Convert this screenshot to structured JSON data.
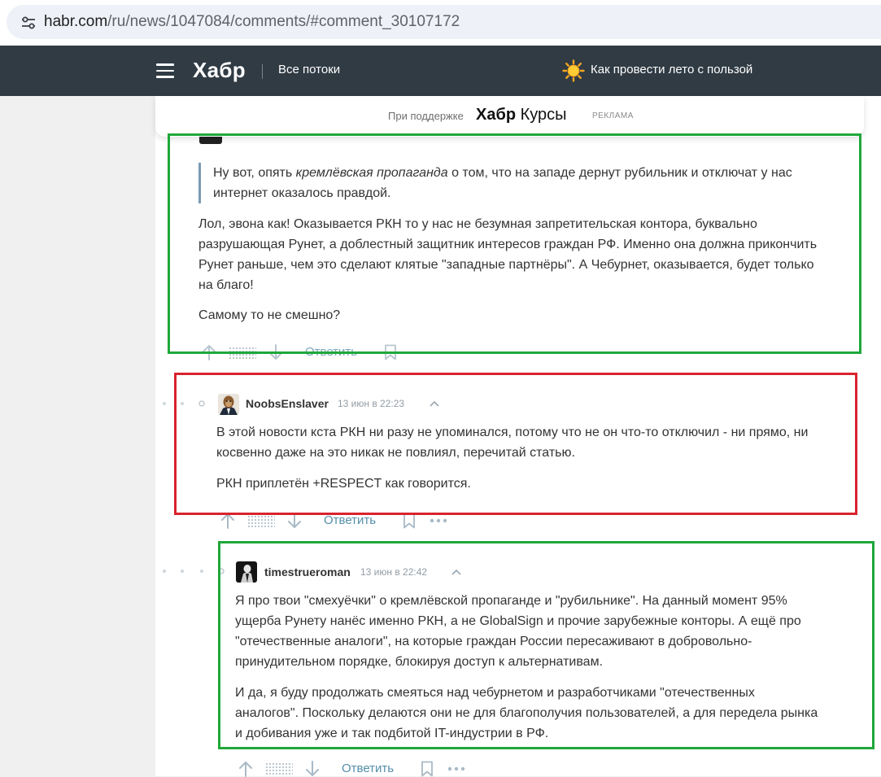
{
  "browser": {
    "url_host": "habr.com",
    "url_path": "/ru/news/1047084/comments/#comment_30107172",
    "site_info_icon": "tune-icon"
  },
  "header": {
    "logo": "Хабр",
    "streams": "Все потоки",
    "promo": "Как провести лето с пользой",
    "promo_icon": "sun-icon"
  },
  "sponsor": {
    "support_text": "При поддержке",
    "logo_bold": "Хабр",
    "logo_regular": "Курсы",
    "ad_label": "РЕКЛАМА"
  },
  "comments": [
    {
      "quote_plain": "Ну вот, опять ",
      "quote_italic": "кремлёвская пропаганда",
      "quote_rest": " о том, что на западе дернут рубильник и отключат у нас",
      "quote_line2": "интернет оказалось правдой.",
      "p1_lines": [
        "Лол, эвона как! Оказывается РКН то у нас не безумная запретительская контора, буквально",
        "разрушающая Рунет, а доблестный защитник интересов граждан РФ. Именно она должна прикончить",
        "Рунет раньше, чем это сделают клятые \"западные партнёры\". А Чебурнет, оказывается, будет только",
        "на благо!"
      ],
      "p2": "Самому то не смешно?",
      "reply_label": "Ответить"
    },
    {
      "username": "NoobsEnslaver",
      "date": "13 июн в 22:23",
      "p1_lines": [
        "В этой новости кста РКН ни разу не упоминался, потому что не он что-то отключил - ни прямо, ни",
        "косвенно даже на это никак не повлиял, перечитай статью."
      ],
      "p2": "РКН приплетён +RESPECT как говорится.",
      "reply_label": "Ответить"
    },
    {
      "username": "timestrueroman",
      "date": "13 июн в 22:42",
      "p1_lines": [
        "Я про твои \"смехуёчки\" о кремлёвской пропаганде и \"рубильнике\". На данный момент 95%",
        "ущерба Рунету нанёс именно РКН, а не GlobalSign и прочие зарубежные конторы. А ещё про",
        "\"отечественные аналоги\", на которые граждан России пересаживают в добровольно-",
        "принудительном порядке, блокируя доступ к альтернативам."
      ],
      "p2_lines": [
        "И да, я буду продолжать смеяться над чебурнетом и разработчиками \"отечественных",
        "аналогов\". Поскольку делаются они не для благополучия пользователей, а для передела рынка",
        "и добивания уже и так подбитой IT-индустрии в РФ."
      ],
      "reply_label": "Ответить"
    }
  ],
  "colors": {
    "header_bg": "#303b44",
    "link": "#548eaa",
    "annotation_green": "#1fa83a",
    "annotation_red": "#d9232d"
  }
}
